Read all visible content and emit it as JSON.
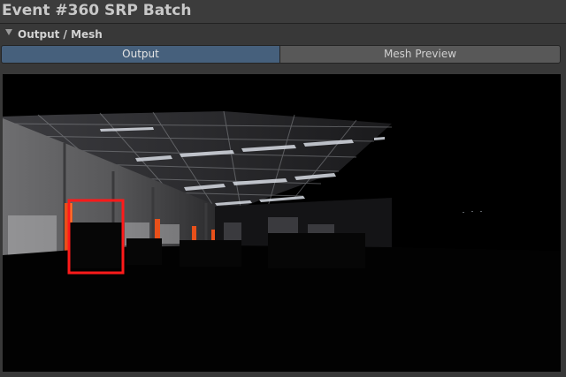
{
  "window": {
    "title": "Event #360 SRP Batch"
  },
  "section": {
    "label": "Output / Mesh",
    "expanded": true
  },
  "tabs": [
    {
      "label": "Output",
      "selected": true
    },
    {
      "label": "Mesh Preview",
      "selected": false
    }
  ],
  "colors": {
    "selected_tab": "#46607c",
    "unselected_tab": "#585858",
    "highlight_rect": "#ff1a1a",
    "panel_bg": "#383838"
  },
  "icons": {
    "foldout": "triangle-down-icon"
  }
}
